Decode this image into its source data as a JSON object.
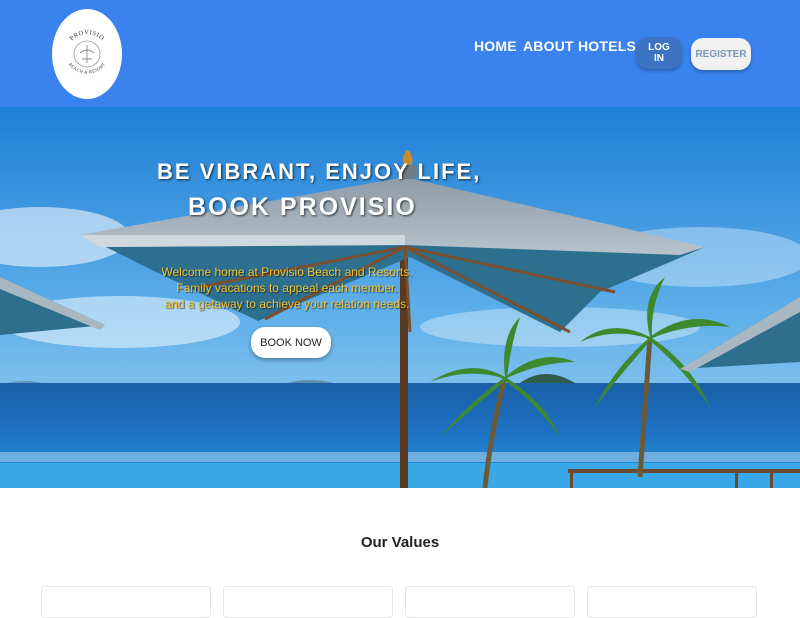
{
  "brand": {
    "logo_top": "PROVISIO",
    "logo_bottom": "BEACH & RESORT"
  },
  "nav": {
    "links": [
      {
        "label": "HOME"
      },
      {
        "label": "ABOUT"
      },
      {
        "label": "HOTELS"
      }
    ],
    "login_label": "LOG IN",
    "register_label": "REGISTER"
  },
  "hero": {
    "title_line1": "BE VIBRANT, ENJOY LIFE,",
    "title_line2": "BOOK PROVISIO",
    "text_lines": [
      "Welcome home at Provisio Beach and Resorts.",
      "Family vacations to appeal each member.",
      "and a getaway to achieve your relation needs."
    ],
    "book_button": "BOOK NOW"
  },
  "values": {
    "title": "Our Values"
  },
  "colors": {
    "nav_bg": "#3a82ee",
    "login_bg": "#3c73c2",
    "hero_text": "#f2c12e"
  }
}
